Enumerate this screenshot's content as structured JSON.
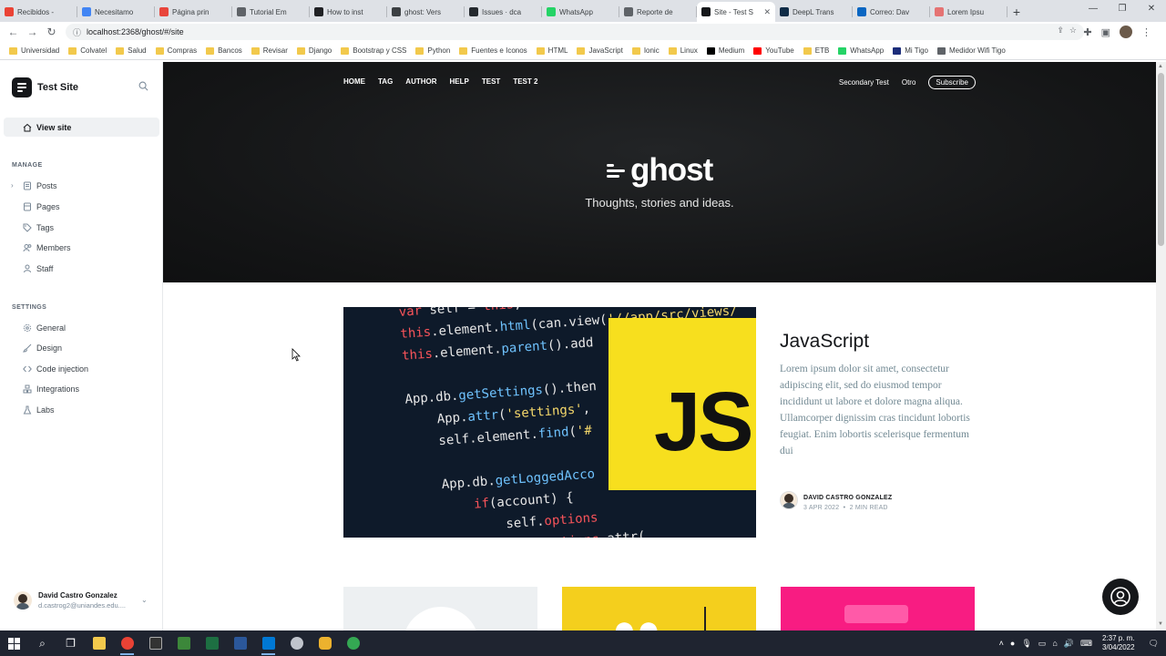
{
  "browser": {
    "tabs": [
      {
        "label": "Recibidos -",
        "color": "#ea4335"
      },
      {
        "label": "Necesitamo",
        "color": "#4285f4"
      },
      {
        "label": "Página prin",
        "color": "#e8453c"
      },
      {
        "label": "Tutorial Em",
        "color": "#5f6368"
      },
      {
        "label": "How to inst",
        "color": "#202124"
      },
      {
        "label": "ghost: Vers",
        "color": "#3c4043"
      },
      {
        "label": "Issues · dca",
        "color": "#24292e"
      },
      {
        "label": "WhatsApp",
        "color": "#25d366"
      },
      {
        "label": "Reporte de",
        "color": "#5f6368"
      },
      {
        "label": "Site - Test S",
        "color": "#15171a",
        "active": true
      },
      {
        "label": "DeepL Trans",
        "color": "#0f2b46"
      },
      {
        "label": "Correo: Dav",
        "color": "#0a66c2"
      },
      {
        "label": "Lorem Ipsu",
        "color": "#e57373"
      }
    ],
    "url": "localhost:2368/ghost/#/site",
    "bookmarks": [
      {
        "label": "Universidad",
        "type": "folder"
      },
      {
        "label": "Colvatel",
        "type": "folder"
      },
      {
        "label": "Salud",
        "type": "folder"
      },
      {
        "label": "Compras",
        "type": "folder"
      },
      {
        "label": "Bancos",
        "type": "folder"
      },
      {
        "label": "Revisar",
        "type": "folder"
      },
      {
        "label": "Django",
        "type": "folder"
      },
      {
        "label": "Bootstrap y CSS",
        "type": "folder"
      },
      {
        "label": "Python",
        "type": "folder"
      },
      {
        "label": "Fuentes e Iconos",
        "type": "folder"
      },
      {
        "label": "HTML",
        "type": "folder"
      },
      {
        "label": "JavaScript",
        "type": "folder"
      },
      {
        "label": "Ionic",
        "type": "folder"
      },
      {
        "label": "Linux",
        "type": "folder"
      },
      {
        "label": "Medium",
        "type": "site",
        "color": "#000000"
      },
      {
        "label": "YouTube",
        "type": "site",
        "color": "#ff0000"
      },
      {
        "label": "ETB",
        "type": "folder"
      },
      {
        "label": "WhatsApp",
        "type": "site",
        "color": "#25d366"
      },
      {
        "label": "Mi Tigo",
        "type": "site",
        "color": "#1c2d7a"
      },
      {
        "label": "Medidor Wifi Tigo",
        "type": "site",
        "color": "#5f6368"
      }
    ]
  },
  "sidebar": {
    "site_title": "Test Site",
    "view_site": "View site",
    "manage_heading": "MANAGE",
    "manage_items": [
      "Posts",
      "Pages",
      "Tags",
      "Members",
      "Staff"
    ],
    "settings_heading": "SETTINGS",
    "settings_items": [
      "General",
      "Design",
      "Code injection",
      "Integrations",
      "Labs"
    ],
    "user": {
      "name": "David Castro Gonzalez",
      "email": "d.castrog2@uniandes.edu...."
    }
  },
  "site": {
    "nav": [
      "HOME",
      "TAG",
      "AUTHOR",
      "HELP",
      "TEST",
      "TEST 2"
    ],
    "secondary_nav": [
      "Secondary Test",
      "Otro"
    ],
    "subscribe": "Subscribe",
    "logo_word": "ghost",
    "tagline": "Thoughts, stories and ideas.",
    "feature_image_text": "JS",
    "featured_post": {
      "title": "JavaScript",
      "excerpt": "Lorem ipsum dolor sit amet, consectetur adipiscing elit, sed do eiusmod tempor incididunt ut labore et dolore magna aliqua. Ullamcorper dignissim cras tincidunt lobortis feugiat. Enim lobortis scelerisque fermentum dui",
      "author": "DAVID CASTRO GONZALEZ",
      "date": "3 APR 2022",
      "reading_time": "2 MIN READ"
    }
  },
  "taskbar": {
    "time": "2:37 p. m.",
    "date": "3/04/2022"
  }
}
